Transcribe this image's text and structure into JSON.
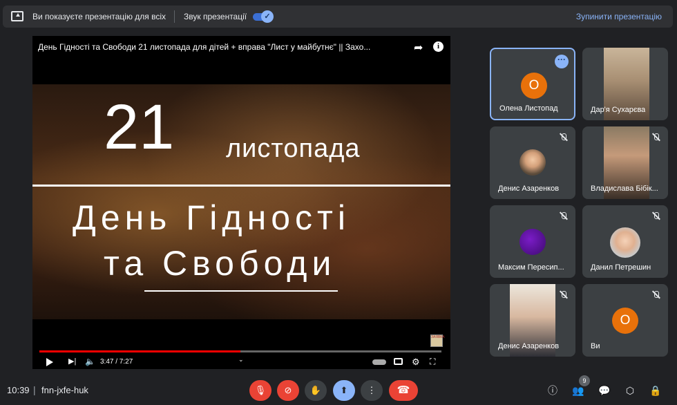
{
  "topbar": {
    "presenting_text": "Ви показуєте презентацію для всіх",
    "sound_label": "Звук презентації",
    "sound_enabled": true,
    "stop_label": "Зупинити презентацію"
  },
  "presentation": {
    "video_title": "День Гідності та Свободи 21 листопада для дітей + вправа \"Лист у майбутнє\" || Захо...",
    "overlay": {
      "day": "21",
      "month": "листопада",
      "line1": "День Гідності",
      "line2": "та Свободи"
    },
    "current_time": "3:47 / 7:27",
    "progress": 0.5,
    "thumb_text": "ЗАЯВКА"
  },
  "participants": [
    {
      "name": "Олена Листопад",
      "avatar_letter": "О",
      "type": "letter",
      "active": true
    },
    {
      "name": "Дар'я Сухарєва",
      "type": "video",
      "active": false
    },
    {
      "name": "Денис Азаренков",
      "type": "photo",
      "active": false,
      "muted": true
    },
    {
      "name": "Владислава Бібік...",
      "type": "video",
      "active": false,
      "muted": true
    },
    {
      "name": "Максим Пересип...",
      "type": "purple",
      "active": false,
      "muted": true
    },
    {
      "name": "Данил Петрешин",
      "type": "photo",
      "active": false,
      "muted": true
    },
    {
      "name": "Денис Азаренков",
      "type": "video",
      "active": false,
      "muted": true
    },
    {
      "name": "Ви",
      "avatar_letter": "О",
      "type": "letter",
      "active": false,
      "muted": true
    }
  ],
  "bottombar": {
    "time": "10:39",
    "separator": "|",
    "meeting_code": "fnn-jxfe-huk",
    "participants_count": "9"
  },
  "colors": {
    "accent": "#8ab4f8",
    "danger": "#ea4335",
    "avatar_orange": "#e8710a",
    "background": "#202124",
    "tile": "#3c4043"
  }
}
